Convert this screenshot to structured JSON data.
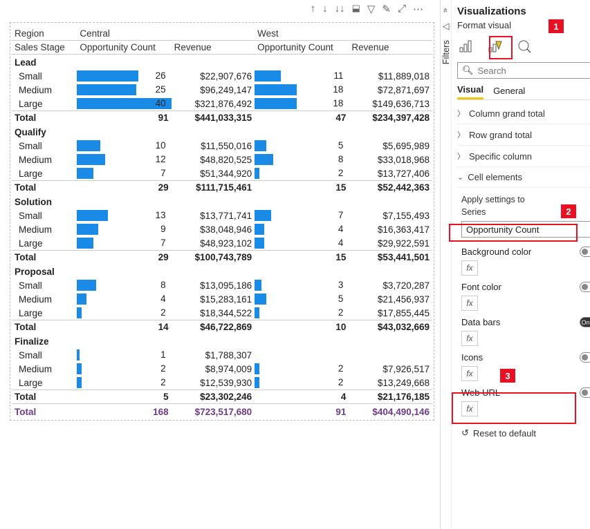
{
  "toolbar_icons": [
    "↑",
    "↓",
    "↓↓",
    "⌐",
    "▽",
    "✎",
    "⤢",
    "⋯"
  ],
  "matrix": {
    "row_headers": [
      "Region",
      "Sales Stage"
    ],
    "columns": [
      "Central",
      "West"
    ],
    "measures": [
      "Opportunity Count",
      "Revenue"
    ],
    "bar_max": 40,
    "stages": [
      {
        "name": "Lead",
        "rows": [
          {
            "size": "Small",
            "c_cnt": 26,
            "c_rev": "$22,907,676",
            "w_cnt": 11,
            "w_rev": "$11,889,018"
          },
          {
            "size": "Medium",
            "c_cnt": 25,
            "c_rev": "$96,249,147",
            "w_cnt": 18,
            "w_rev": "$72,871,697"
          },
          {
            "size": "Large",
            "c_cnt": 40,
            "c_rev": "$321,876,492",
            "w_cnt": 18,
            "w_rev": "$149,636,713"
          }
        ],
        "total": {
          "c_cnt": 91,
          "c_rev": "$441,033,315",
          "w_cnt": 47,
          "w_rev": "$234,397,428"
        }
      },
      {
        "name": "Qualify",
        "rows": [
          {
            "size": "Small",
            "c_cnt": 10,
            "c_rev": "$11,550,016",
            "w_cnt": 5,
            "w_rev": "$5,695,989"
          },
          {
            "size": "Medium",
            "c_cnt": 12,
            "c_rev": "$48,820,525",
            "w_cnt": 8,
            "w_rev": "$33,018,968"
          },
          {
            "size": "Large",
            "c_cnt": 7,
            "c_rev": "$51,344,920",
            "w_cnt": 2,
            "w_rev": "$13,727,406"
          }
        ],
        "total": {
          "c_cnt": 29,
          "c_rev": "$111,715,461",
          "w_cnt": 15,
          "w_rev": "$52,442,363"
        }
      },
      {
        "name": "Solution",
        "rows": [
          {
            "size": "Small",
            "c_cnt": 13,
            "c_rev": "$13,771,741",
            "w_cnt": 7,
            "w_rev": "$7,155,493"
          },
          {
            "size": "Medium",
            "c_cnt": 9,
            "c_rev": "$38,048,946",
            "w_cnt": 4,
            "w_rev": "$16,363,417"
          },
          {
            "size": "Large",
            "c_cnt": 7,
            "c_rev": "$48,923,102",
            "w_cnt": 4,
            "w_rev": "$29,922,591"
          }
        ],
        "total": {
          "c_cnt": 29,
          "c_rev": "$100,743,789",
          "w_cnt": 15,
          "w_rev": "$53,441,501"
        }
      },
      {
        "name": "Proposal",
        "rows": [
          {
            "size": "Small",
            "c_cnt": 8,
            "c_rev": "$13,095,186",
            "w_cnt": 3,
            "w_rev": "$3,720,287"
          },
          {
            "size": "Medium",
            "c_cnt": 4,
            "c_rev": "$15,283,161",
            "w_cnt": 5,
            "w_rev": "$21,456,937"
          },
          {
            "size": "Large",
            "c_cnt": 2,
            "c_rev": "$18,344,522",
            "w_cnt": 2,
            "w_rev": "$17,855,445"
          }
        ],
        "total": {
          "c_cnt": 14,
          "c_rev": "$46,722,869",
          "w_cnt": 10,
          "w_rev": "$43,032,669"
        }
      },
      {
        "name": "Finalize",
        "rows": [
          {
            "size": "Small",
            "c_cnt": 1,
            "c_rev": "$1,788,307",
            "w_cnt": null,
            "w_rev": ""
          },
          {
            "size": "Medium",
            "c_cnt": 2,
            "c_rev": "$8,974,009",
            "w_cnt": 2,
            "w_rev": "$7,926,517"
          },
          {
            "size": "Large",
            "c_cnt": 2,
            "c_rev": "$12,539,930",
            "w_cnt": 2,
            "w_rev": "$13,249,668"
          }
        ],
        "total": {
          "c_cnt": 5,
          "c_rev": "$23,302,246",
          "w_cnt": 4,
          "w_rev": "$21,176,185"
        }
      }
    ],
    "grand": {
      "label": "Total",
      "c_cnt": 168,
      "c_rev": "$723,517,680",
      "w_cnt": 91,
      "w_rev": "$404,490,146"
    }
  },
  "panel": {
    "title": "Visualizations",
    "subtitle": "Format visual",
    "filters_label": "Filters",
    "search_placeholder": "Search",
    "tabs": [
      "Visual",
      "General"
    ],
    "accordions": [
      "Column grand total",
      "Row grand total",
      "Specific column",
      "Cell elements"
    ],
    "cell_elements": {
      "apply_label": "Apply settings to",
      "series_label": "Series",
      "series_value": "Opportunity Count",
      "options": [
        {
          "name": "Background color",
          "state": "Off"
        },
        {
          "name": "Font color",
          "state": "Off"
        },
        {
          "name": "Data bars",
          "state": "On"
        },
        {
          "name": "Icons",
          "state": "Off"
        },
        {
          "name": "Web URL",
          "state": "Off"
        }
      ]
    },
    "reset": "Reset to default"
  },
  "callouts": [
    "1",
    "2",
    "3"
  ]
}
